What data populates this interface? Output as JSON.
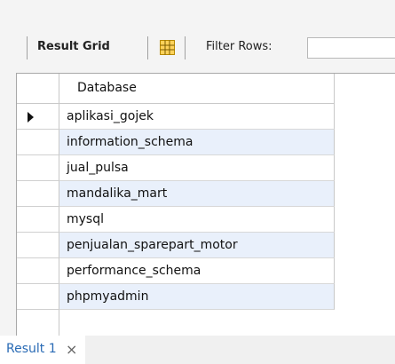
{
  "toolbar": {
    "result_grid_label": "Result Grid",
    "filter_rows_label": "Filter Rows:",
    "filter_value": ""
  },
  "grid": {
    "column_header": "Database",
    "selected_row_index": 0,
    "rows": [
      "aplikasi_gojek",
      "information_schema",
      "jual_pulsa",
      "mandalika_mart",
      "mysql",
      "penjualan_sparepart_motor",
      "performance_schema",
      "phpmyadmin"
    ]
  },
  "tabs": {
    "result_tab_label": "Result 1",
    "close_glyph": "×"
  },
  "colors": {
    "accent": "#2a6bb5",
    "alt_row": "#e9f0fb",
    "grid_icon": "#e0a000"
  },
  "icons": {
    "grid_view": "form-grid-icon",
    "row_marker": "current-row-arrow-icon",
    "tab_close": "close-icon"
  }
}
